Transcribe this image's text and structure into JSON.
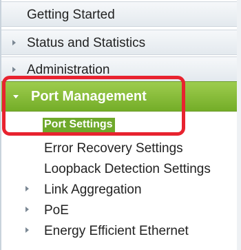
{
  "menu": {
    "getting_started": "Getting Started",
    "status_and_statistics": "Status and Statistics",
    "administration": "Administration",
    "port_management": {
      "label": "Port Management",
      "expanded": true,
      "items": {
        "port_settings": "Port Settings",
        "error_recovery_settings": "Error Recovery Settings",
        "loopback_detection_settings": "Loopback Detection Settings",
        "link_aggregation": "Link Aggregation",
        "poe": "PoE",
        "energy_efficient_ethernet": "Energy Efficient Ethernet"
      }
    }
  },
  "colors": {
    "selected_bg": "#74ad28",
    "selected_item_bg": "#6fa92b",
    "highlight_border": "#e8232f"
  }
}
